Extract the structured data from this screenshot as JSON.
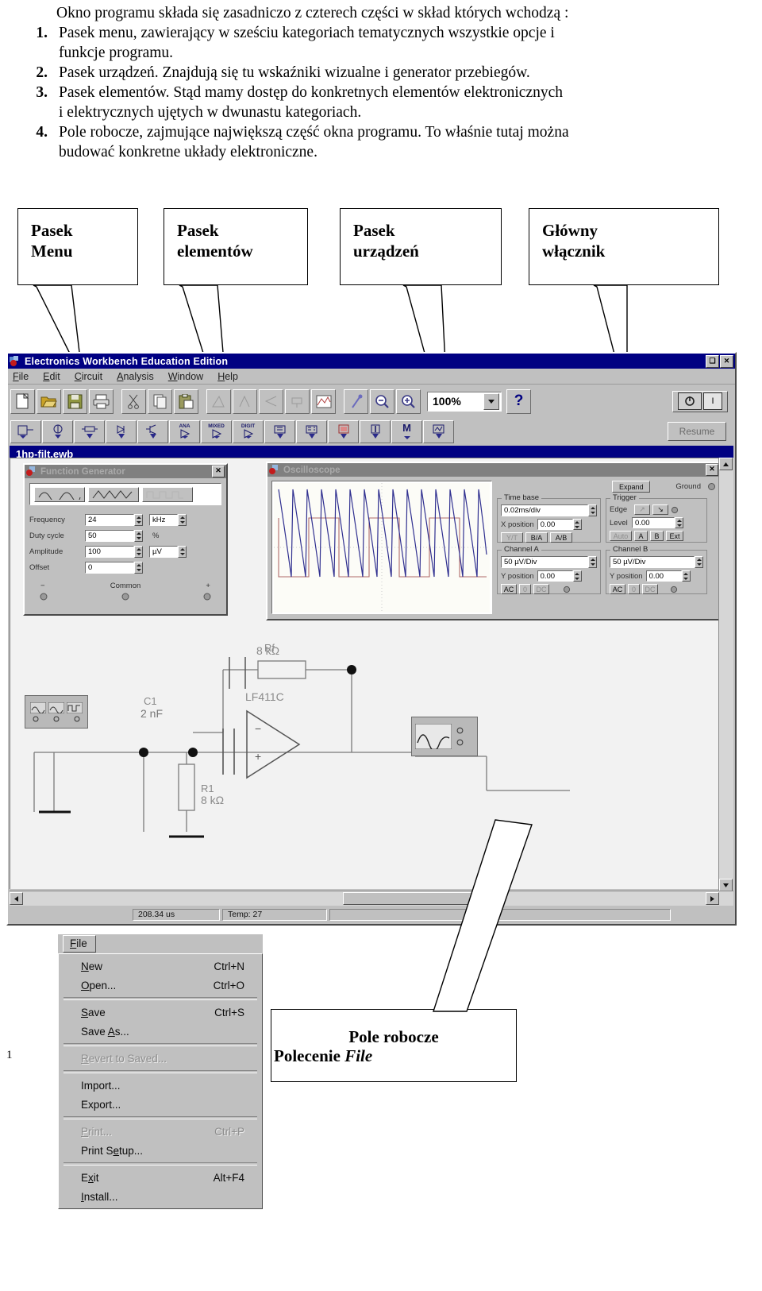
{
  "intro": {
    "lead": "Okno programu składa się zasadniczo z czterech części  w skład których wchodzą :",
    "items": [
      {
        "num": "1.",
        "line1": "Pasek menu, zawierający w sześciu kategoriach tematycznych wszystkie opcje i",
        "line2": "funkcje programu."
      },
      {
        "num": "2.",
        "line1": "Pasek urządzeń. Znajdują się tu wskaźniki wizualne i generator przebiegów.",
        "line2": ""
      },
      {
        "num": "3.",
        "line1": "Pasek elementów. Stąd mamy dostęp do konkretnych elementów elektronicznych",
        "line2": "i elektrycznych ujętych w dwunastu kategoriach."
      },
      {
        "num": "4.",
        "line1": "Pole robocze, zajmujące największą część okna programu. To właśnie tutaj można",
        "line2": "budować konkretne układy elektroniczne."
      }
    ]
  },
  "callouts": [
    {
      "l1": "Pasek",
      "l2": "Menu"
    },
    {
      "l1": "Pasek",
      "l2": "elementów"
    },
    {
      "l1": "Pasek",
      "l2": "urządzeń"
    },
    {
      "l1": "Główny",
      "l2": "włącznik"
    }
  ],
  "bottom_captions": {
    "workspace": "Pole robocze",
    "file_command_prefix": "Polecenie ",
    "file_command_italic": "File",
    "page_number": "1"
  },
  "ewb": {
    "title": "Electronics Workbench Education Edition",
    "titlebar_buttons": [
      "restore-button",
      "close-button"
    ],
    "menu": [
      {
        "pre": "",
        "hk": "F",
        "post": "ile"
      },
      {
        "pre": "",
        "hk": "E",
        "post": "dit"
      },
      {
        "pre": "",
        "hk": "C",
        "post": "ircuit"
      },
      {
        "pre": "",
        "hk": "A",
        "post": "nalysis"
      },
      {
        "pre": "",
        "hk": "W",
        "post": "indow"
      },
      {
        "pre": "",
        "hk": "H",
        "post": "elp"
      }
    ],
    "toolbar_icons": [
      "new-file-icon",
      "open-folder-icon",
      "save-disk-icon",
      "print-icon",
      "cut-scissors-icon",
      "copy-icon",
      "paste-icon",
      "rotate-icon",
      "flip-horizontal-icon",
      "flip-vertical-icon",
      "create-subcircuit-icon",
      "display-graphs-icon",
      "component-properties-icon",
      "zoom-out-icon",
      "zoom-in-icon"
    ],
    "zoom_value": "100%",
    "help_label": "?",
    "power_switch": "main-power-switch",
    "resume_label": "Resume",
    "parts_toolbar": [
      "favorites-bin-icon",
      "sources-icon",
      "basic-icon",
      "diodes-icon",
      "transistors-icon",
      "ANA",
      "MIXED",
      "DIGIT",
      "ics-icon",
      "logic-gates-icon",
      "indicators-icon",
      "controls-icon",
      "M",
      "miscellaneous-icon"
    ],
    "document_title": "1hp-filt.ewb",
    "status": {
      "time": "208.34 us",
      "temp": "Temp: 27"
    }
  },
  "function_generator": {
    "title": "Function Generator",
    "waveforms": [
      "sine-wave-button",
      "triangle-wave-button",
      "square-wave-button"
    ],
    "fields": [
      {
        "label": "Frequency",
        "value": "24",
        "unit": "kHz"
      },
      {
        "label": "Duty cycle",
        "value": "50",
        "unit": "%"
      },
      {
        "label": "Amplitude",
        "value": "100",
        "unit": "µV"
      },
      {
        "label": "Offset",
        "value": "0",
        "unit": ""
      }
    ],
    "terminals": {
      "minus": "−",
      "common": "Common",
      "plus": "+"
    }
  },
  "oscilloscope": {
    "title": "Oscilloscope",
    "expand_label": "Expand",
    "ground_label": "Ground",
    "time_base": {
      "group": "Time base",
      "value": "0.02ms/div",
      "x_position_label": "X position",
      "x_position": "0.00",
      "modes": [
        "Y/T",
        "B/A",
        "A/B"
      ]
    },
    "trigger": {
      "group": "Trigger",
      "edge_label": "Edge",
      "level_label": "Level",
      "level": "0.00",
      "sources": [
        "Auto",
        "A",
        "B",
        "Ext"
      ]
    },
    "channel_a": {
      "group": "Channel A",
      "scale": "50 µV/Div",
      "y_position_label": "Y position",
      "y_position": "0.00",
      "coupling": [
        "AC",
        "0",
        "DC"
      ]
    },
    "channel_b": {
      "group": "Channel B",
      "scale": "50 µV/Div",
      "y_position_label": "Y position",
      "y_position": "0.00",
      "coupling": [
        "AC",
        "0",
        "DC"
      ]
    }
  },
  "circuit": {
    "components": [
      {
        "ref": "Rf",
        "value": "8 kΩ"
      },
      {
        "ref": "C1",
        "value": "2 nF"
      },
      {
        "ref": "R1",
        "value": "8 kΩ"
      },
      {
        "ref": "LF411C",
        "value": ""
      }
    ]
  },
  "file_menu": {
    "header": {
      "pre": "",
      "hk": "F",
      "post": "ile"
    },
    "groups": [
      [
        {
          "pre": "",
          "hk": "N",
          "post": "ew",
          "accel": "Ctrl+N",
          "disabled": false
        },
        {
          "pre": "",
          "hk": "O",
          "post": "pen...",
          "accel": "Ctrl+O",
          "disabled": false
        }
      ],
      [
        {
          "pre": "",
          "hk": "S",
          "post": "ave",
          "accel": "Ctrl+S",
          "disabled": false
        },
        {
          "pre": "Save ",
          "hk": "A",
          "post": "s...",
          "accel": "",
          "disabled": false
        }
      ],
      [
        {
          "pre": "",
          "hk": "R",
          "post": "evert to Saved...",
          "accel": "",
          "disabled": true
        }
      ],
      [
        {
          "pre": "Import...",
          "hk": "",
          "post": "",
          "accel": "",
          "disabled": false
        },
        {
          "pre": "Export...",
          "hk": "",
          "post": "",
          "accel": "",
          "disabled": false
        }
      ],
      [
        {
          "pre": "",
          "hk": "P",
          "post": "rint...",
          "accel": "Ctrl+P",
          "disabled": true
        },
        {
          "pre": "Print S",
          "hk": "e",
          "post": "tup...",
          "accel": "",
          "disabled": false
        }
      ],
      [
        {
          "pre": "E",
          "hk": "x",
          "post": "it",
          "accel": "Alt+F4",
          "disabled": false
        },
        {
          "pre": "",
          "hk": "I",
          "post": "nstall...",
          "accel": "",
          "disabled": false
        }
      ]
    ]
  },
  "colors": {
    "titlebar": "#000082",
    "face": "#c0c0c0",
    "workspace": "#f2f2f2",
    "trace_a": "#b06a6a",
    "trace_b": "#303090"
  }
}
